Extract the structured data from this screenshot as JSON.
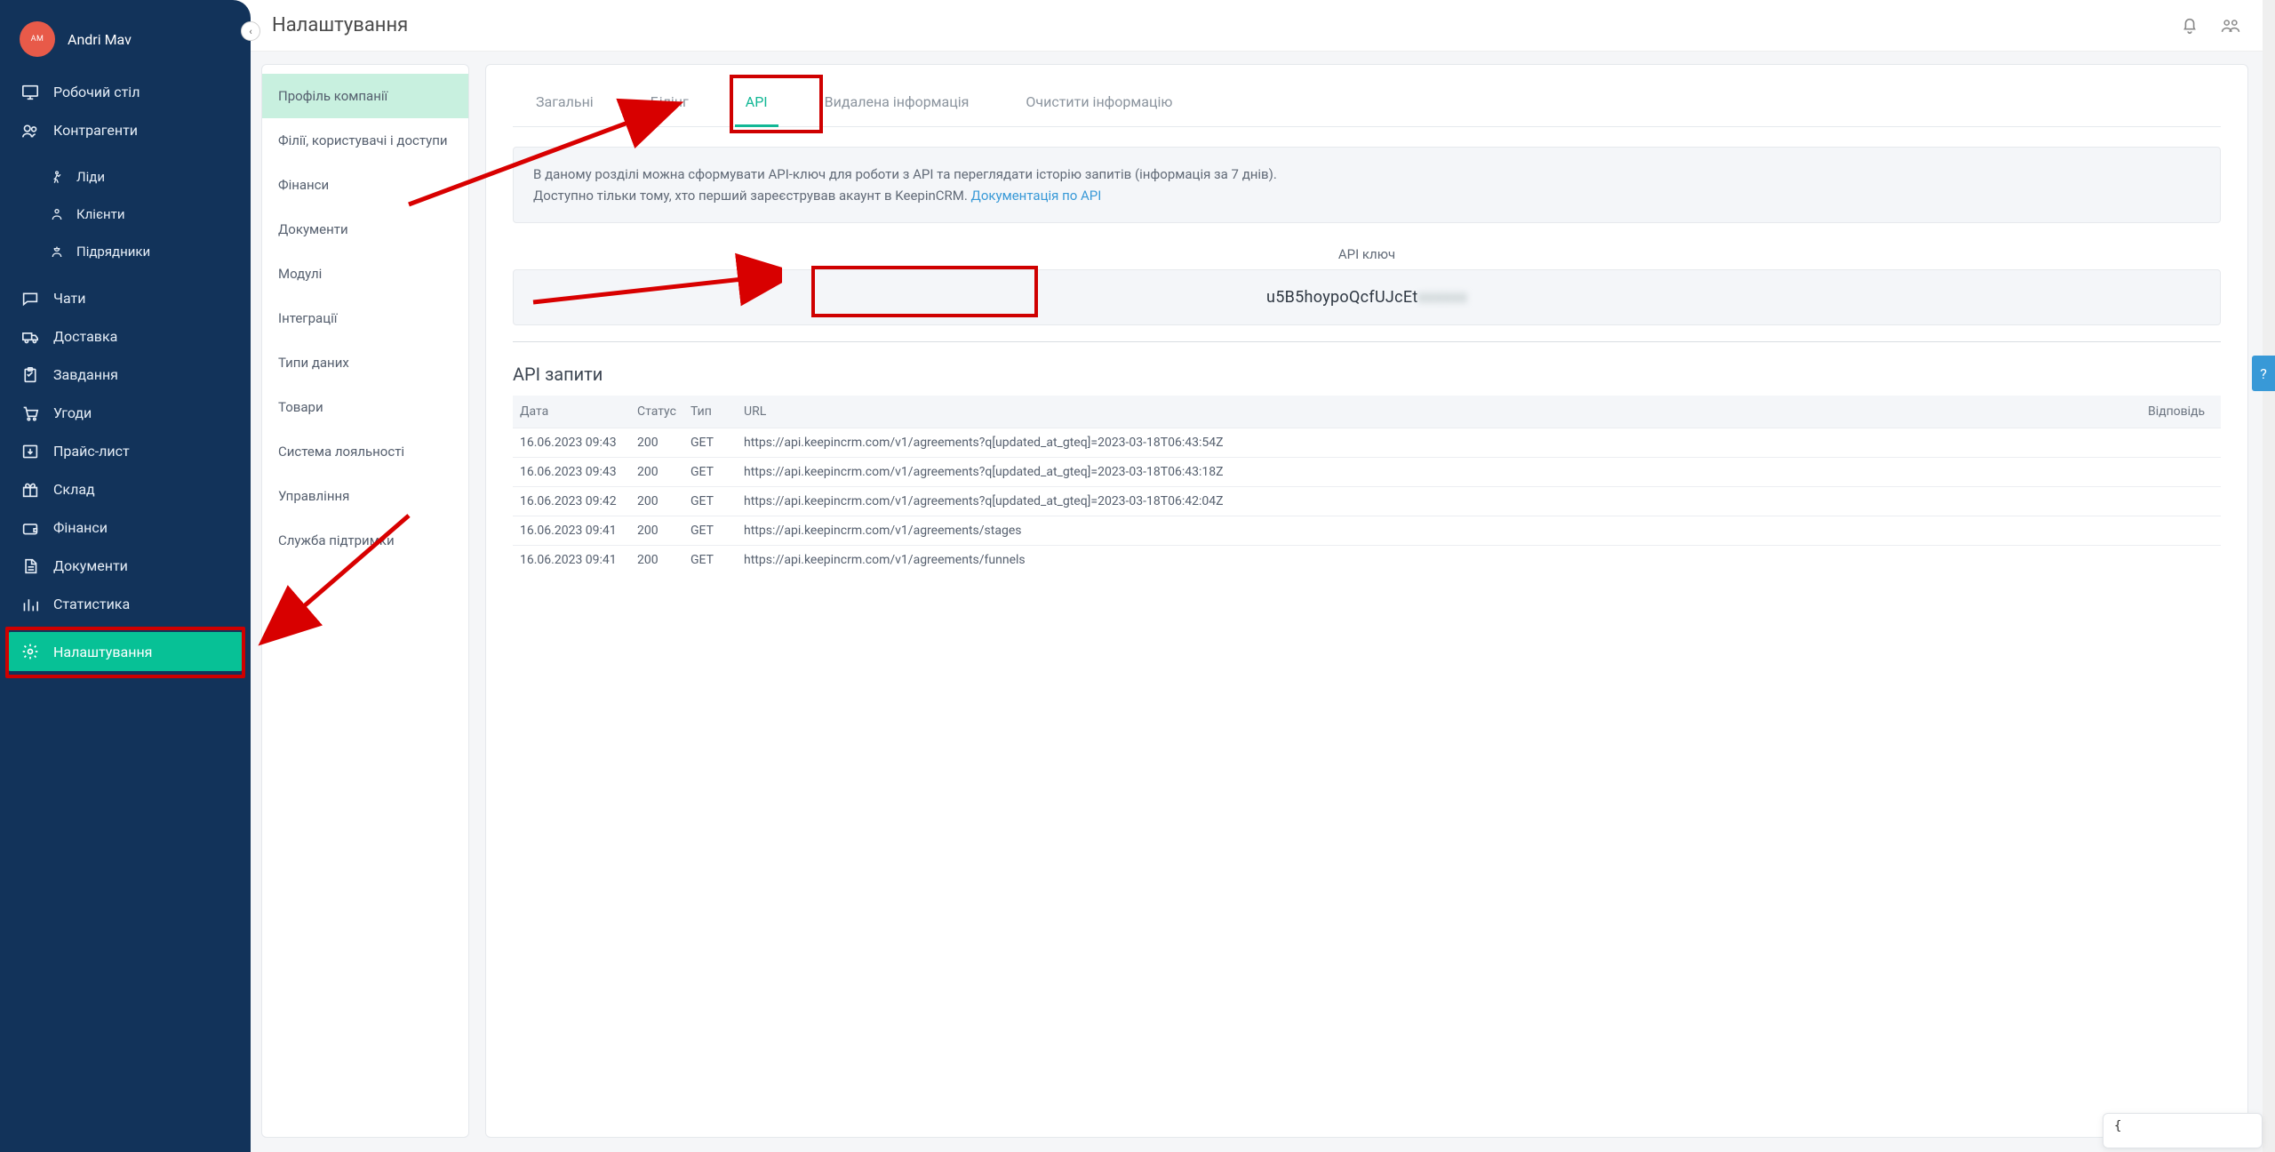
{
  "user": {
    "initials": "AM",
    "name": "Andri Mav"
  },
  "header": {
    "title": "Налаштування"
  },
  "sidebar": {
    "items": [
      {
        "label": "Робочий стіл"
      },
      {
        "label": "Контрагенти"
      },
      {
        "label": "Ліди"
      },
      {
        "label": "Клієнти"
      },
      {
        "label": "Підрядники"
      },
      {
        "label": "Чати"
      },
      {
        "label": "Доставка"
      },
      {
        "label": "Завдання"
      },
      {
        "label": "Угоди"
      },
      {
        "label": "Прайс-лист"
      },
      {
        "label": "Склад"
      },
      {
        "label": "Фінанси"
      },
      {
        "label": "Документи"
      },
      {
        "label": "Статистика"
      },
      {
        "label": "Налаштування"
      }
    ]
  },
  "settings_nav": {
    "items": [
      {
        "label": "Профіль компанії"
      },
      {
        "label": "Філії, користувачі і доступи"
      },
      {
        "label": "Фінанси"
      },
      {
        "label": "Документи"
      },
      {
        "label": "Модулі"
      },
      {
        "label": "Інтеграції"
      },
      {
        "label": "Типи даних"
      },
      {
        "label": "Товари"
      },
      {
        "label": "Система лояльності"
      },
      {
        "label": "Управління"
      },
      {
        "label": "Служба підтримки"
      }
    ]
  },
  "tabs": {
    "items": [
      {
        "label": "Загальні"
      },
      {
        "label": "Білінг"
      },
      {
        "label": "API"
      },
      {
        "label": "Видалена інформація"
      },
      {
        "label": "Очистити інформацію"
      }
    ]
  },
  "info": {
    "line1": "В даному розділі можна сформувати API-ключ для роботи з API та переглядати історію запитів (інформація за 7 днів).",
    "line2_prefix": "Доступно тільки тому, хто перший зареєстрував акаунт в KeepinCRM. ",
    "doc_link": "Документація по API"
  },
  "api_key": {
    "label": "API ключ",
    "value_visible": "u5B5hoypoQcfUJcEt",
    "value_masked": "xxxxxx"
  },
  "requests": {
    "title": "API запити",
    "cols": {
      "date": "Дата",
      "status": "Статус",
      "type": "Тип",
      "url": "URL",
      "response": "Відповідь"
    },
    "rows": [
      {
        "date": "16.06.2023 09:43",
        "status": "200",
        "type": "GET",
        "url": "https://api.keepincrm.com/v1/agreements?q[updated_at_gteq]=2023-03-18T06:43:54Z",
        "response": ""
      },
      {
        "date": "16.06.2023 09:43",
        "status": "200",
        "type": "GET",
        "url": "https://api.keepincrm.com/v1/agreements?q[updated_at_gteq]=2023-03-18T06:43:18Z",
        "response": ""
      },
      {
        "date": "16.06.2023 09:42",
        "status": "200",
        "type": "GET",
        "url": "https://api.keepincrm.com/v1/agreements?q[updated_at_gteq]=2023-03-18T06:42:04Z",
        "response": ""
      },
      {
        "date": "16.06.2023 09:41",
        "status": "200",
        "type": "GET",
        "url": "https://api.keepincrm.com/v1/agreements/stages",
        "response": ""
      },
      {
        "date": "16.06.2023 09:41",
        "status": "200",
        "type": "GET",
        "url": "https://api.keepincrm.com/v1/agreements/funnels",
        "response": ""
      }
    ]
  },
  "help": {
    "label": "?"
  },
  "chat_float": {
    "text": "{"
  },
  "annotations": {
    "highlight_tab": "API",
    "highlight_sidebar": "Налаштування",
    "highlight_api_key": true,
    "arrows": [
      "to-api-tab",
      "to-api-key",
      "to-settings"
    ]
  }
}
